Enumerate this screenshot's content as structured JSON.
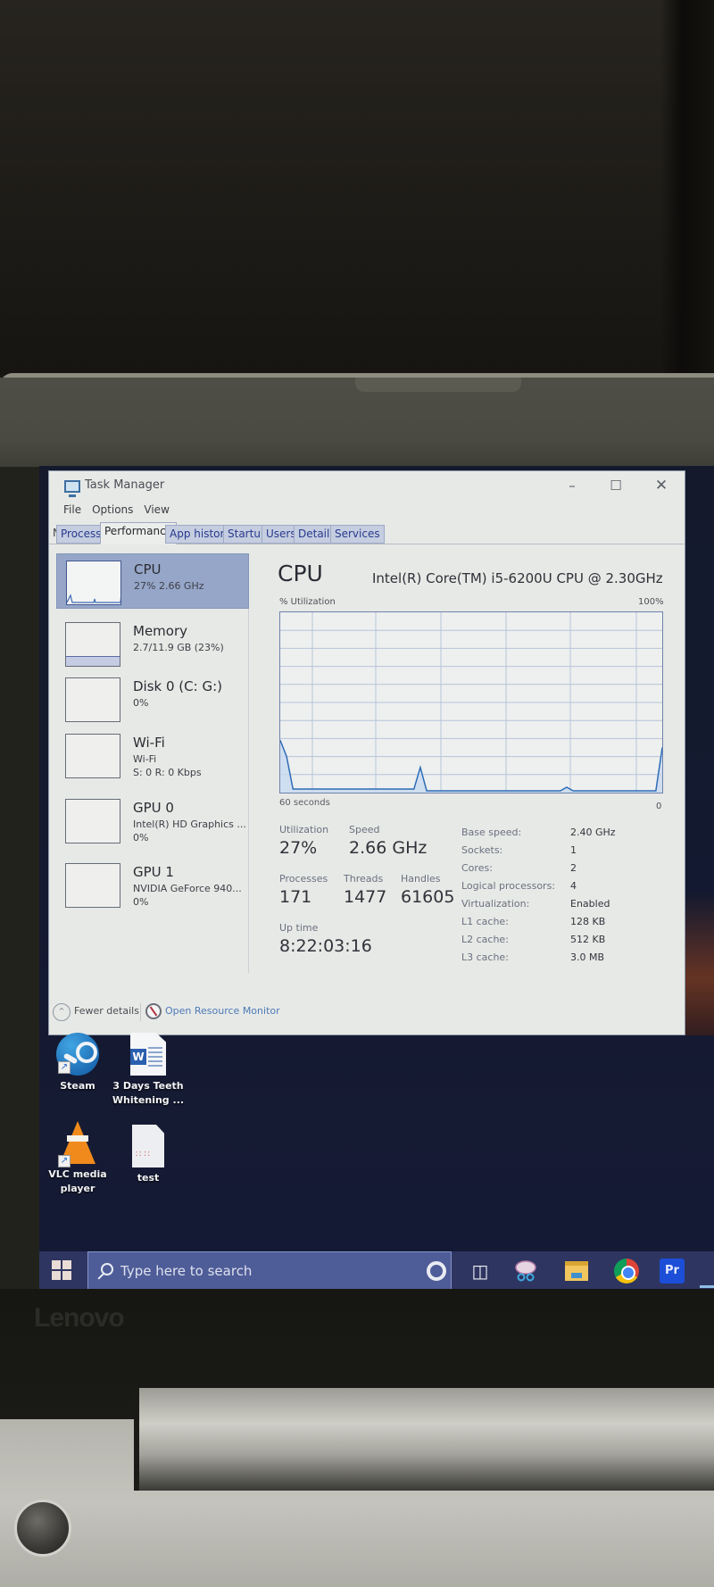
{
  "window": {
    "title": "Task Manager",
    "controls": {
      "minimize": "–",
      "maximize": "☐",
      "close": "✕"
    }
  },
  "menu": [
    "File",
    "Options",
    "View"
  ],
  "tabs": [
    {
      "label": "Processes",
      "active": false
    },
    {
      "label": "Performance",
      "active": true
    },
    {
      "label": "App history",
      "active": false
    },
    {
      "label": "Startup",
      "active": false
    },
    {
      "label": "Users",
      "active": false
    },
    {
      "label": "Details",
      "active": false
    },
    {
      "label": "Services",
      "active": false
    }
  ],
  "sidebar": {
    "items": [
      {
        "name": "CPU",
        "sub1": "27% 2.66 GHz",
        "sub2": "",
        "selected": true
      },
      {
        "name": "Memory",
        "sub1": "2.7/11.9 GB (23%)",
        "sub2": "",
        "selected": false,
        "usage_percent": 23
      },
      {
        "name": "Disk 0 (C: G:)",
        "sub1": "0%",
        "sub2": "",
        "selected": false
      },
      {
        "name": "Wi-Fi",
        "sub1": "Wi-Fi",
        "sub2": "S: 0 R: 0 Kbps",
        "selected": false
      },
      {
        "name": "GPU 0",
        "sub1": "Intel(R) HD Graphics ...",
        "sub2": "0%",
        "selected": false
      },
      {
        "name": "GPU 1",
        "sub1": "NVIDIA GeForce 940...",
        "sub2": "0%",
        "selected": false
      }
    ]
  },
  "main": {
    "title": "CPU",
    "model": "Intel(R) Core(TM) i5-6200U CPU @ 2.30GHz",
    "graph": {
      "y_label": "% Utilization",
      "y_max_label": "100%",
      "x_label": "60 seconds",
      "x_min_label": "0"
    },
    "stats": {
      "utilization": {
        "label": "Utilization",
        "value": "27%"
      },
      "speed": {
        "label": "Speed",
        "value": "2.66 GHz"
      },
      "processes": {
        "label": "Processes",
        "value": "171"
      },
      "threads": {
        "label": "Threads",
        "value": "1477"
      },
      "handles": {
        "label": "Handles",
        "value": "61605"
      },
      "uptime": {
        "label": "Up time",
        "value": "8:22:03:16"
      }
    },
    "details": [
      {
        "label": "Base speed:",
        "value": "2.40 GHz"
      },
      {
        "label": "Sockets:",
        "value": "1"
      },
      {
        "label": "Cores:",
        "value": "2"
      },
      {
        "label": "Logical processors:",
        "value": "4"
      },
      {
        "label": "Virtualization:",
        "value": "Enabled"
      },
      {
        "label": "L1 cache:",
        "value": "128 KB"
      },
      {
        "label": "L2 cache:",
        "value": "512 KB"
      },
      {
        "label": "L3 cache:",
        "value": "3.0 MB"
      }
    ]
  },
  "footer": {
    "fewer_details": "Fewer details",
    "open_resource_monitor": "Open Resource Monitor"
  },
  "chart_data": {
    "type": "area",
    "title": "% Utilization",
    "xlabel": "60 seconds",
    "ylabel": "% Utilization",
    "ylim": [
      0,
      100
    ],
    "xlim": [
      60,
      0
    ],
    "grid": true,
    "x": [
      60,
      59,
      58,
      57,
      56,
      55,
      54,
      53,
      52,
      51,
      50,
      49,
      48,
      47,
      46,
      45,
      44,
      43,
      42,
      41,
      40,
      39,
      38,
      37,
      36,
      35,
      34,
      33,
      32,
      31,
      30,
      29,
      28,
      27,
      26,
      25,
      24,
      23,
      22,
      21,
      20,
      19,
      18,
      17,
      16,
      15,
      14,
      13,
      12,
      11,
      10,
      9,
      8,
      7,
      6,
      5,
      4,
      3,
      2,
      1,
      0
    ],
    "values": [
      29,
      20,
      2,
      2,
      2,
      2,
      2,
      2,
      2,
      2,
      2,
      2,
      2,
      2,
      2,
      2,
      2,
      2,
      2,
      2,
      2,
      2,
      14,
      1,
      1,
      1,
      1,
      1,
      1,
      1,
      1,
      1,
      1,
      1,
      1,
      1,
      1,
      1,
      1,
      1,
      1,
      1,
      1,
      1,
      1,
      3,
      1,
      1,
      1,
      1,
      1,
      1,
      1,
      1,
      1,
      1,
      1,
      1,
      1,
      1,
      25
    ]
  },
  "desktop": {
    "icons": [
      {
        "label": "Steam",
        "shortcut": true
      },
      {
        "label": "3 Days Teeth Whitening ...",
        "shortcut": false
      },
      {
        "label": "VLC media player",
        "shortcut": true
      },
      {
        "label": "test",
        "shortcut": false
      }
    ]
  },
  "taskbar": {
    "search_placeholder": "Type here to search",
    "pinned": [
      "cortana",
      "task-view",
      "snip",
      "file-explorer",
      "chrome",
      "premiere-pro"
    ],
    "premiere_label": "Pr"
  },
  "device": {
    "brand": "Lenovo"
  }
}
